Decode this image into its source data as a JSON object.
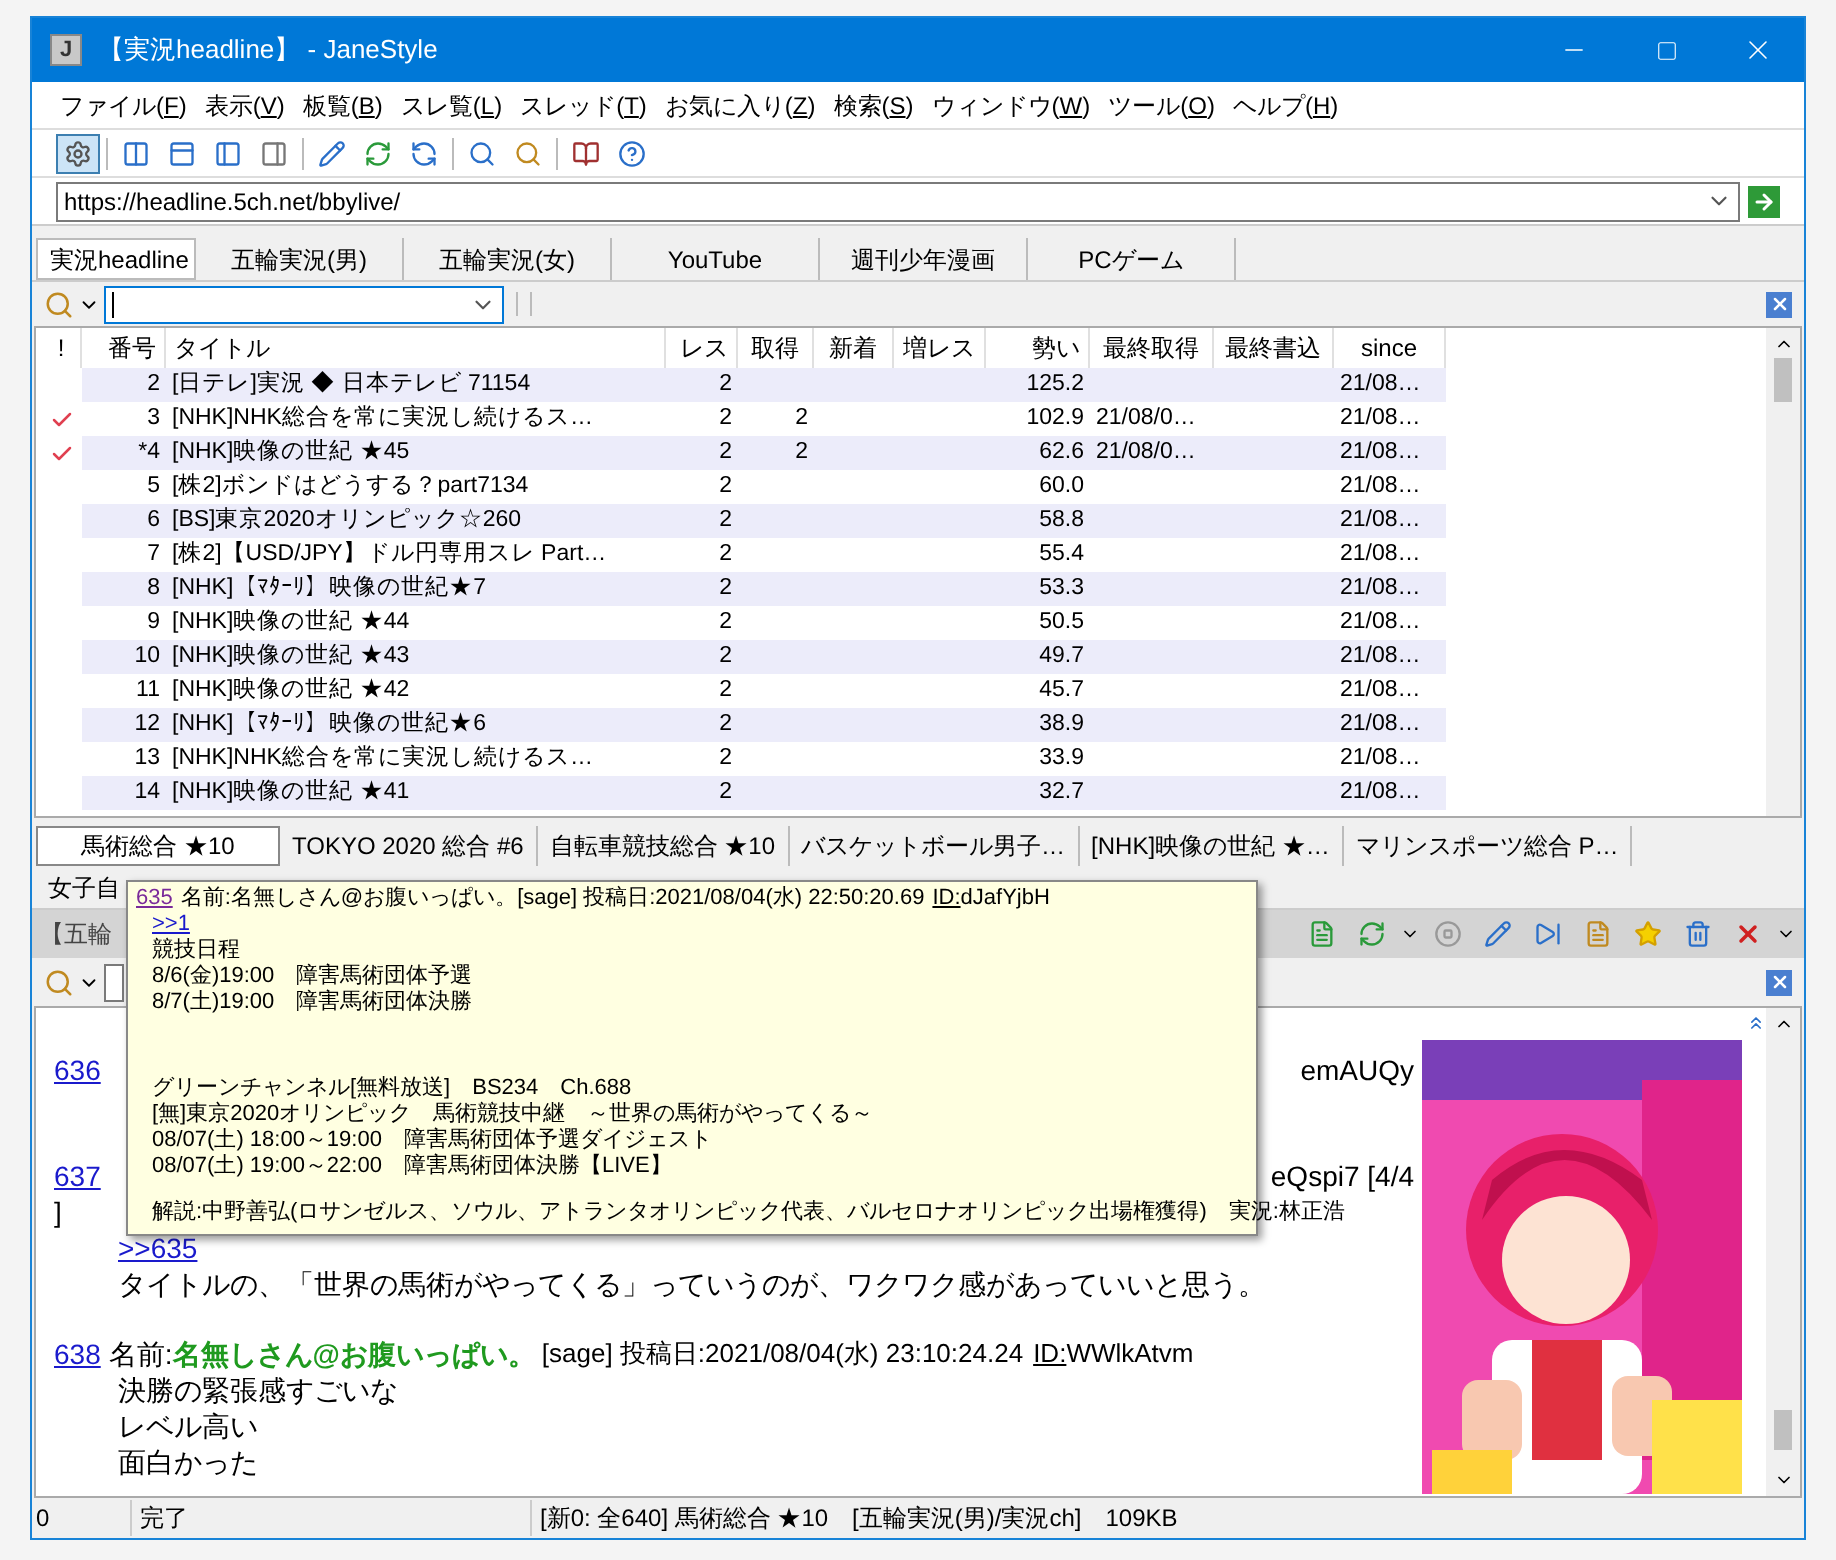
{
  "window": {
    "icon_letter": "J",
    "title": "【実況headline】 - JaneStyle"
  },
  "menu": [
    {
      "before": "ファイル(",
      "key": "F",
      "after": ")"
    },
    {
      "before": "表示(",
      "key": "V",
      "after": ")"
    },
    {
      "before": "板覧(",
      "key": "B",
      "after": ")"
    },
    {
      "before": "スレ覧(",
      "key": "L",
      "after": ")"
    },
    {
      "before": "スレッド(",
      "key": "T",
      "after": ")"
    },
    {
      "before": "お気に入り(",
      "key": "Z",
      "after": ")"
    },
    {
      "before": "検索(",
      "key": "S",
      "after": ")"
    },
    {
      "before": "ウィンドウ(",
      "key": "W",
      "after": ")"
    },
    {
      "before": "ツール(",
      "key": "O",
      "after": ")"
    },
    {
      "before": "ヘルプ(",
      "key": "H",
      "after": ")"
    }
  ],
  "address": {
    "value": "https://headline.5ch.net/bbylive/"
  },
  "board_tabs": [
    {
      "label": "実況headline",
      "selected": true
    },
    {
      "label": "五輪実況(男)",
      "selected": false
    },
    {
      "label": "五輪実況(女)",
      "selected": false
    },
    {
      "label": "YouTube",
      "selected": false
    },
    {
      "label": "週刊少年漫画",
      "selected": false
    },
    {
      "label": "PCゲーム",
      "selected": false
    }
  ],
  "table": {
    "columns": [
      "!",
      "番号",
      "タイトル",
      "レス",
      "取得",
      "新着",
      "増レス",
      "勢い",
      "最終取得",
      "最終書込",
      "since"
    ],
    "rows": [
      {
        "checked": false,
        "num": "2",
        "title": "[日テレ]実況 ◆ 日本テレビ 71154",
        "res": "2",
        "got": "",
        "speed": "125.2",
        "last_got": "",
        "since": "21/08…"
      },
      {
        "checked": true,
        "num": "3",
        "title": "[NHK]NHK総合を常に実況し続けるス…",
        "res": "2",
        "got": "2",
        "speed": "102.9",
        "last_got": "21/08/0…",
        "since": "21/08…"
      },
      {
        "checked": true,
        "num": "*4",
        "title": "[NHK]映像の世紀 ★45",
        "res": "2",
        "got": "2",
        "speed": "62.6",
        "last_got": "21/08/0…",
        "since": "21/08…"
      },
      {
        "checked": false,
        "num": "5",
        "title": "[株2]ボンドはどうする？part7134",
        "res": "2",
        "got": "",
        "speed": "60.0",
        "last_got": "",
        "since": "21/08…"
      },
      {
        "checked": false,
        "num": "6",
        "title": "[BS]東京2020オリンピック☆260",
        "res": "2",
        "got": "",
        "speed": "58.8",
        "last_got": "",
        "since": "21/08…"
      },
      {
        "checked": false,
        "num": "7",
        "title": "[株2]【USD/JPY】ドル円専用スレ Part…",
        "res": "2",
        "got": "",
        "speed": "55.4",
        "last_got": "",
        "since": "21/08…"
      },
      {
        "checked": false,
        "num": "8",
        "title": "[NHK]【ﾏﾀｰﾘ】映像の世紀★7",
        "res": "2",
        "got": "",
        "speed": "53.3",
        "last_got": "",
        "since": "21/08…"
      },
      {
        "checked": false,
        "num": "9",
        "title": "[NHK]映像の世紀 ★44",
        "res": "2",
        "got": "",
        "speed": "50.5",
        "last_got": "",
        "since": "21/08…"
      },
      {
        "checked": false,
        "num": "10",
        "title": "[NHK]映像の世紀 ★43",
        "res": "2",
        "got": "",
        "speed": "49.7",
        "last_got": "",
        "since": "21/08…"
      },
      {
        "checked": false,
        "num": "11",
        "title": "[NHK]映像の世紀 ★42",
        "res": "2",
        "got": "",
        "speed": "45.7",
        "last_got": "",
        "since": "21/08…"
      },
      {
        "checked": false,
        "num": "12",
        "title": "[NHK]【ﾏﾀｰﾘ】映像の世紀★6",
        "res": "2",
        "got": "",
        "speed": "38.9",
        "last_got": "",
        "since": "21/08…"
      },
      {
        "checked": false,
        "num": "13",
        "title": "[NHK]NHK総合を常に実況し続けるス…",
        "res": "2",
        "got": "",
        "speed": "33.9",
        "last_got": "",
        "since": "21/08…"
      },
      {
        "checked": false,
        "num": "14",
        "title": "[NHK]映像の世紀 ★41",
        "res": "2",
        "got": "",
        "speed": "32.7",
        "last_got": "",
        "since": "21/08…"
      }
    ]
  },
  "thread_tabs": [
    {
      "label": "馬術総合 ★10",
      "selected": true
    },
    {
      "label": "TOKYO 2020 総合 #6",
      "selected": false
    },
    {
      "label": "自転車競技総合 ★10",
      "selected": false
    },
    {
      "label": "バスケットボール男子…",
      "selected": false
    },
    {
      "label": "[NHK]映像の世紀 ★…",
      "selected": false
    },
    {
      "label": "マリンスポーツ総合 P…",
      "selected": false
    }
  ],
  "thread_tabs_row2": [
    {
      "label": "女子自",
      "selected": false
    }
  ],
  "thread_pane": {
    "title": "【五輪"
  },
  "posts": [
    {
      "kind": "partial",
      "number": "636",
      "tail": "emAUQy"
    },
    {
      "kind": "partial",
      "number": "637",
      "tail": "eQspi7 [4/4",
      "tail_wrap": "]",
      "anchor": ">>635",
      "lines": [
        "タイトルの、「世界の馬術がやってくる」っていうのが、ワクワク感があっていいと思う。"
      ]
    },
    {
      "kind": "full",
      "number": "638",
      "label": "名前:",
      "name": "名無しさん@お腹いっぱい。",
      "info": "[sage] 投稿日:2021/08/04(水) 23:10:24.24",
      "id_label": "ID:",
      "id": "WWlkAtvm",
      "lines": [
        "決勝の緊張感すごいな",
        "レベル高い",
        "面白かった"
      ]
    }
  ],
  "popup": {
    "number": "635",
    "header": "名前:名無しさん@お腹いっぱい。[sage] 投稿日:2021/08/04(水) 22:50:20.69",
    "id_label": "ID:",
    "id": "dJafYjbH",
    "anchor": ">>1",
    "paragraphs": [
      [
        "競技日程",
        "8/6(金)19:00　障害馬術団体予選",
        "8/7(土)19:00　障害馬術団体決勝"
      ],
      [
        "グリーンチャンネル[無料放送]　BS234　Ch.688",
        "[無]東京2020オリンピック　馬術競技中継　～世界の馬術がやってくる～",
        "08/07(土) 18:00～19:00　障害馬術団体予選ダイジェスト",
        "08/07(土) 19:00～22:00　障害馬術団体決勝【LIVE】"
      ],
      [
        "解説:中野善弘(ロサンゼルス、ソウル、アトランタオリンピック代表、バルセロナオリンピック出場権獲得)　実況:林正浩"
      ]
    ]
  },
  "status_bar": [
    "0",
    "完了",
    "[新0: 全640] 馬術総合 ★10　[五輪実況(男)/実況ch]　109KB"
  ]
}
